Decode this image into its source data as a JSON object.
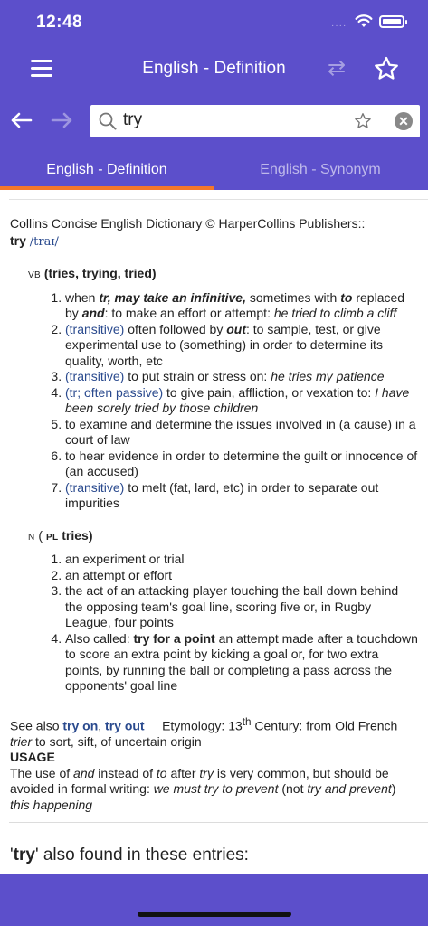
{
  "status": {
    "time": "12:48",
    "signal": "····"
  },
  "nav": {
    "title": "English - Definition",
    "swap_icon": "⇄"
  },
  "search": {
    "query": "try",
    "clear_icon": "✕"
  },
  "tabs": [
    {
      "label": "English - Definition"
    },
    {
      "label": "English - Synonym"
    }
  ],
  "entry": {
    "source": "Collins Concise English Dictionary © HarperCollins Publishers::",
    "headword": "try",
    "pronunciation": "/traɪ/",
    "verb": {
      "pos": "VB",
      "forms": "(tries, trying, tried)",
      "senses": [
        {
          "parts": [
            {
              "t": "when "
            },
            {
              "t": "tr, may take an infinitive,",
              "s": "bi"
            },
            {
              "t": " sometimes with "
            },
            {
              "t": "to",
              "s": "bi"
            },
            {
              "t": " replaced by "
            },
            {
              "t": "and",
              "s": "bi"
            },
            {
              "t": ": to make an effort or attempt: "
            },
            {
              "t": "he tried to climb a cliff",
              "s": "i"
            }
          ]
        },
        {
          "parts": [
            {
              "t": "(transitive)",
              "s": "label"
            },
            {
              "t": " often followed by "
            },
            {
              "t": "out",
              "s": "bi"
            },
            {
              "t": ": to sample, test, or give experimental use to (something) in order to determine its quality, worth, etc"
            }
          ]
        },
        {
          "parts": [
            {
              "t": "(transitive)",
              "s": "label"
            },
            {
              "t": " to put strain or stress on: "
            },
            {
              "t": "he tries my patience",
              "s": "i"
            }
          ]
        },
        {
          "parts": [
            {
              "t": "(tr; often passive)",
              "s": "label"
            },
            {
              "t": " to give pain, affliction, or vexation to: "
            },
            {
              "t": "I have been sorely tried by those children",
              "s": "i"
            }
          ]
        },
        {
          "parts": [
            {
              "t": "to examine and determine the issues involved in (a cause) in a court of law"
            }
          ]
        },
        {
          "parts": [
            {
              "t": "to hear evidence in order to determine the guilt or innocence of (an accused)"
            }
          ]
        },
        {
          "parts": [
            {
              "t": "(transitive)",
              "s": "label"
            },
            {
              "t": " to melt (fat, lard, etc) in order to separate out impurities"
            }
          ]
        }
      ]
    },
    "noun": {
      "pos": "N",
      "open": "(",
      "pl": "PL",
      "form": "tries)",
      "senses": [
        {
          "parts": [
            {
              "t": "an experiment or trial"
            }
          ]
        },
        {
          "parts": [
            {
              "t": "an attempt or effort"
            }
          ]
        },
        {
          "parts": [
            {
              "t": "the act of an attacking player touching the ball down behind the opposing team's goal line, scoring five or, in Rugby League, four points"
            }
          ]
        },
        {
          "parts": [
            {
              "t": "Also called: "
            },
            {
              "t": "try for a point",
              "s": "b"
            },
            {
              "t": " an attempt made after a touchdown to score an extra point by kicking a goal or, for two extra points, by running the ball or completing a pass across the opponents' goal line"
            }
          ]
        }
      ]
    },
    "see_also": {
      "label": "See also",
      "links": [
        "try on",
        "try out"
      ],
      "etym_label": "Etymology: 13",
      "etym_sup": "th",
      "etym_text": " Century: from Old French",
      "etym_word": "trier",
      "etym_rest": " to sort, sift, of uncertain origin"
    },
    "usage": {
      "heading": "USAGE",
      "parts": [
        {
          "t": "The use of "
        },
        {
          "t": "and",
          "s": "i"
        },
        {
          "t": " instead of "
        },
        {
          "t": "to",
          "s": "i"
        },
        {
          "t": " after "
        },
        {
          "t": "try",
          "s": "i"
        },
        {
          "t": " is very common, but should be avoided in formal writing: "
        },
        {
          "t": "we must try to prevent",
          "s": "i"
        },
        {
          "t": " (not "
        },
        {
          "t": "try and prevent",
          "s": "i"
        },
        {
          "t": ") "
        },
        {
          "t": "this happening",
          "s": "i"
        }
      ]
    }
  },
  "found_in": {
    "quote_open": "'",
    "word": "try",
    "rest": "' also found in these entries:"
  }
}
